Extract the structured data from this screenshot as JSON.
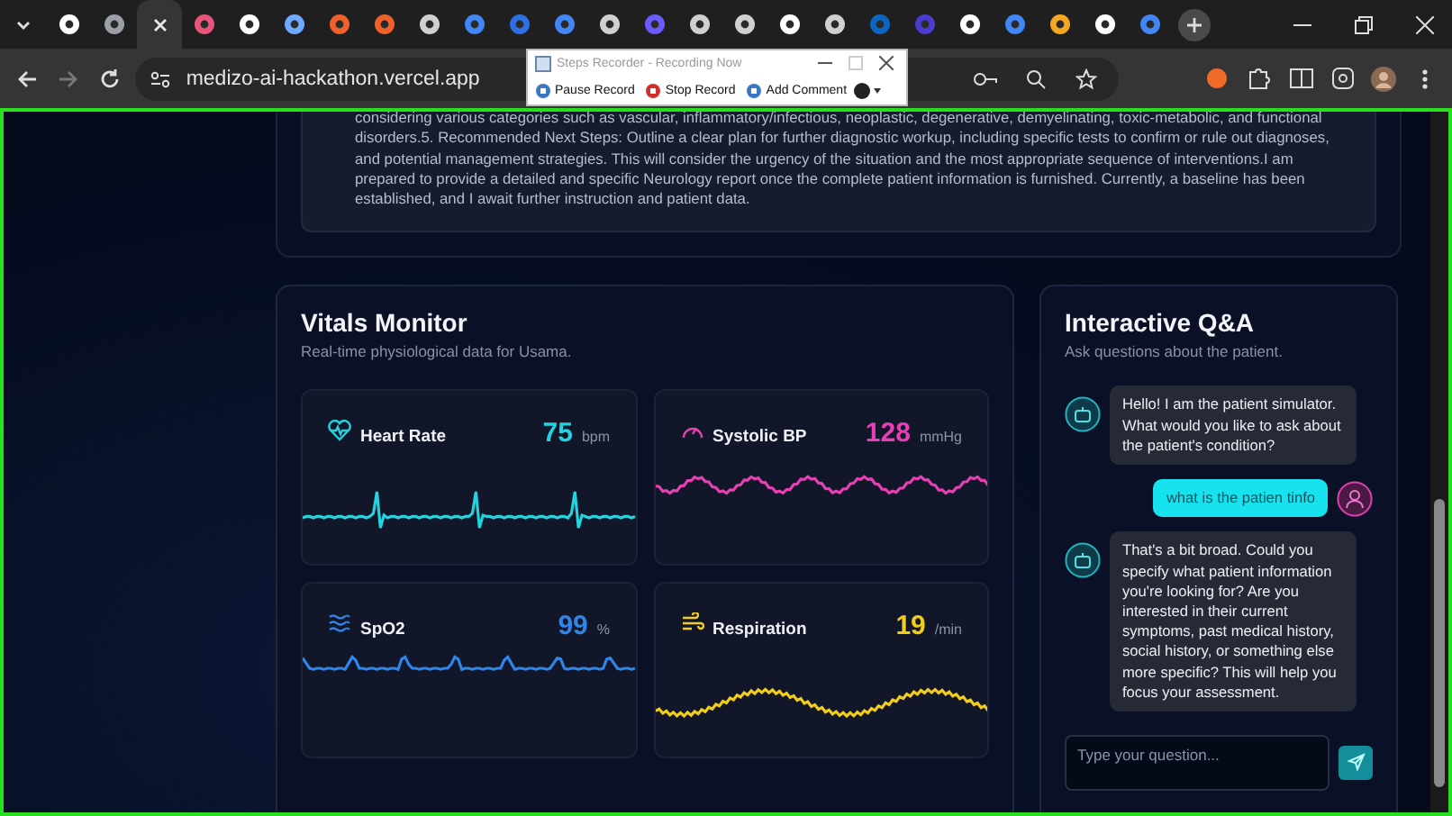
{
  "browser": {
    "tabs": [
      {
        "selected": false
      },
      {
        "selected": false
      },
      {
        "selected": true
      },
      {
        "selected": false
      },
      {
        "selected": false
      },
      {
        "selected": false
      },
      {
        "selected": false
      },
      {
        "selected": false
      },
      {
        "selected": false
      },
      {
        "selected": false
      },
      {
        "selected": false
      },
      {
        "selected": false
      },
      {
        "selected": false
      },
      {
        "selected": false
      },
      {
        "selected": false
      },
      {
        "selected": false
      },
      {
        "selected": false
      },
      {
        "selected": false
      },
      {
        "selected": false
      },
      {
        "selected": false
      },
      {
        "selected": false
      },
      {
        "selected": false
      },
      {
        "selected": false
      },
      {
        "selected": false
      },
      {
        "selected": false
      }
    ],
    "address": "medizo-ai-hackathon.vercel.app"
  },
  "steps_recorder": {
    "title": "Steps Recorder - Recording Now",
    "buttons": [
      "Pause Record",
      "Stop Record",
      "Add Comment"
    ]
  },
  "report": {
    "text": "considering various categories such as vascular, inflammatory/infectious, neoplastic, degenerative, demyelinating, toxic-metabolic, and functional disorders.5. Recommended Next Steps: Outline a clear plan for further diagnostic workup, including specific tests to confirm or rule out diagnoses, and potential management strategies. This will consider the urgency of the situation and the most appropriate sequence of interventions.I am prepared to provide a detailed and specific Neurology report once the complete patient information is furnished. Currently, a baseline has been established, and I await further instruction and patient data."
  },
  "vitals": {
    "title": "Vitals Monitor",
    "subtitle": "Real-time physiological data for Usama.",
    "cards": [
      {
        "kind": "ecg",
        "name": "Heart Rate",
        "value": "75",
        "unit": "bpm",
        "color": "#22d3e0"
      },
      {
        "kind": "bp",
        "name": "Systolic BP",
        "value": "128",
        "unit": "mmHg",
        "color": "#e83fb4"
      },
      {
        "kind": "spo2",
        "name": "SpO2",
        "value": "99",
        "unit": "%",
        "color": "#2f86e8"
      },
      {
        "kind": "resp",
        "name": "Respiration",
        "value": "19",
        "unit": "/min",
        "color": "#f2cd1c"
      }
    ]
  },
  "qa": {
    "title": "Interactive Q&A",
    "subtitle": "Ask questions about the patient.",
    "messages": [
      {
        "kind": "bot",
        "text": "Hello! I am the patient simulator. What would you like to ask about the patient's condition?"
      },
      {
        "kind": "user",
        "text": "what is the patien tinfo"
      },
      {
        "kind": "bot",
        "text": "That's a bit broad. Could you specify what patient information you're looking for? Are you interested in their current symptoms, past medical history, social history, or something else more specific? This will help you focus your assessment."
      }
    ],
    "input": {
      "placeholder": "Type your question..."
    }
  }
}
